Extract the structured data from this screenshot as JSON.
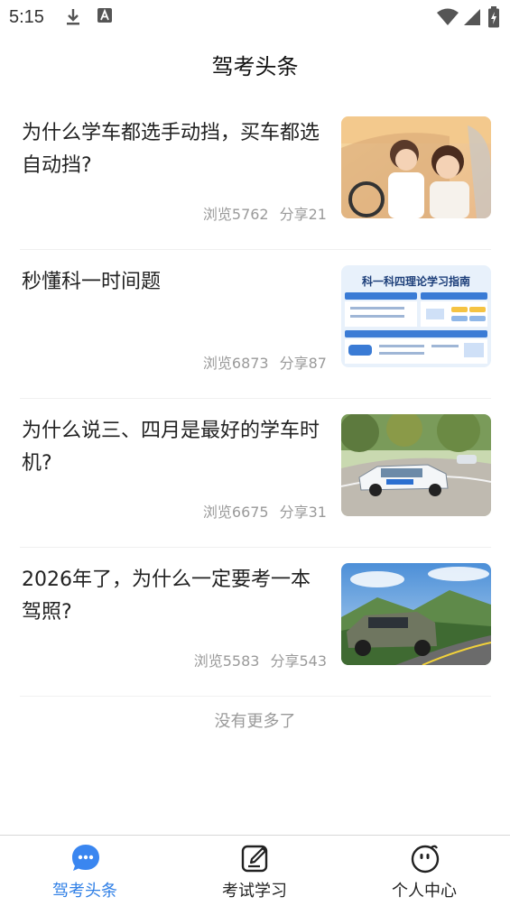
{
  "status_bar": {
    "time": "5:15"
  },
  "header": {
    "title": "驾考头条"
  },
  "news": [
    {
      "title": "为什么学车都选手动挡，买车都选自动挡?",
      "views": "浏览5762",
      "shares": "分享21"
    },
    {
      "title": "秒懂科一时间题",
      "views": "浏览6873",
      "shares": "分享87",
      "thumb": {
        "heading": "科一科四理论学习指南"
      }
    },
    {
      "title": "为什么说三、四月是最好的学车时机?",
      "views": "浏览6675",
      "shares": "分享31"
    },
    {
      "title": "2026年了，为什么一定要考一本驾照?",
      "views": "浏览5583",
      "shares": "分享543"
    }
  ],
  "footer_note": "没有更多了",
  "tabs": [
    {
      "label": "驾考头条",
      "icon": "chat-bubble-icon",
      "active": true
    },
    {
      "label": "考试学习",
      "icon": "edit-note-icon",
      "active": false
    },
    {
      "label": "个人中心",
      "icon": "smiley-face-icon",
      "active": false
    }
  ],
  "colors": {
    "accent": "#2f7fe6",
    "muted": "#9a9a9a"
  }
}
